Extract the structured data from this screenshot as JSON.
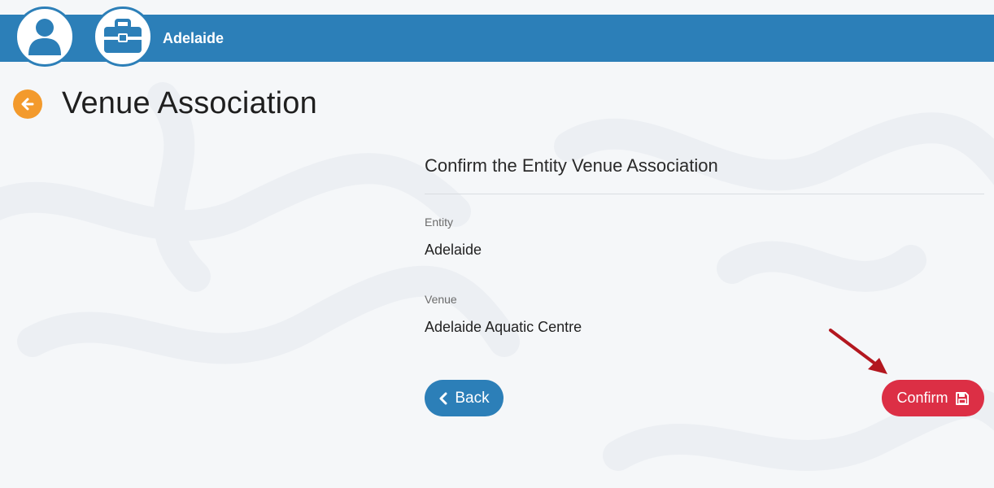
{
  "header": {
    "entity_name": "Adelaide",
    "user_icon": "user-icon",
    "entity_icon": "briefcase-icon",
    "bar_color": "#2c7fb8"
  },
  "page": {
    "title": "Venue Association",
    "back_icon": "arrow-left-icon",
    "back_icon_color": "#f39a2c"
  },
  "panel": {
    "title": "Confirm the Entity Venue Association",
    "fields": [
      {
        "label": "Entity",
        "value": "Adelaide"
      },
      {
        "label": "Venue",
        "value": "Adelaide Aquatic Centre"
      }
    ]
  },
  "actions": {
    "back_label": "Back",
    "back_icon": "chevron-left-icon",
    "back_color": "#2c7fb8",
    "confirm_label": "Confirm",
    "confirm_icon": "save-icon",
    "confirm_color": "#dc2f45"
  },
  "annotation": {
    "icon": "red-arrow-pointer-icon",
    "color": "#b3171f"
  }
}
